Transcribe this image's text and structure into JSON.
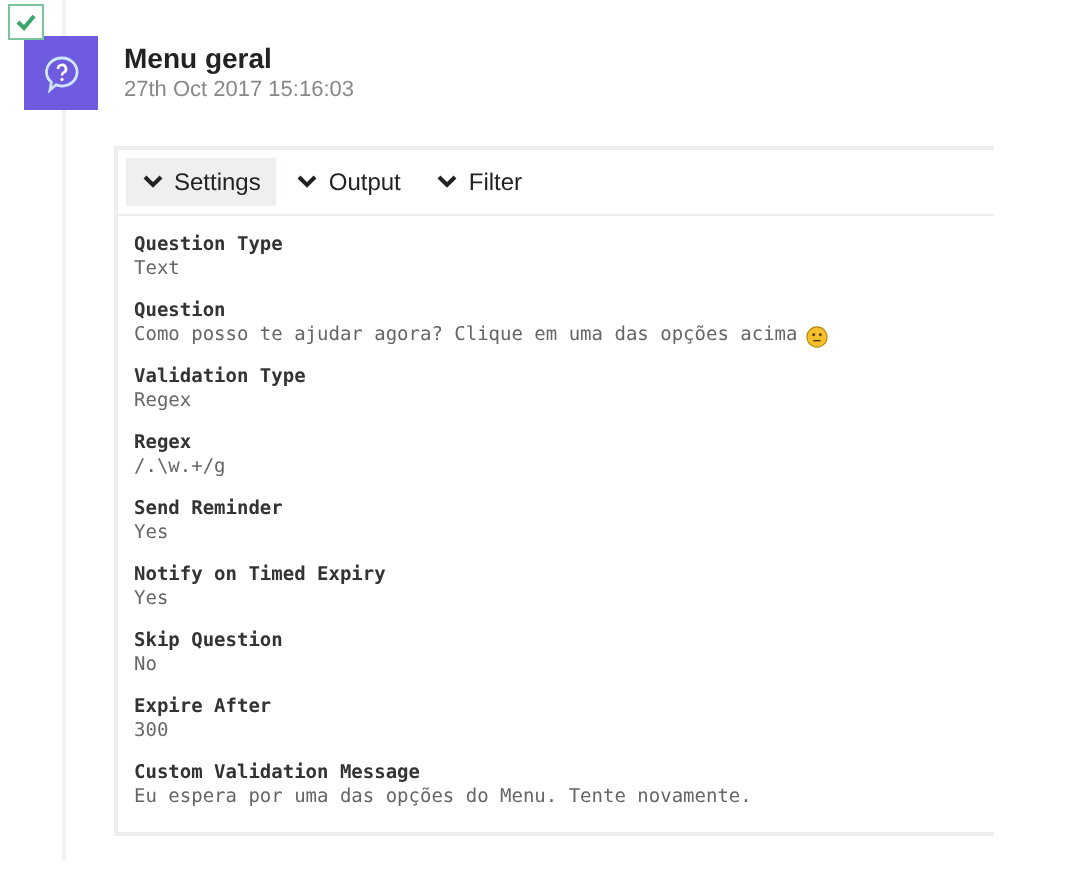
{
  "entry": {
    "checked": true,
    "title": "Menu geral",
    "timestamp": "27th Oct 2017 15:16:03"
  },
  "tabs": [
    {
      "label": "Settings",
      "selected": true
    },
    {
      "label": "Output",
      "selected": false
    },
    {
      "label": "Filter",
      "selected": false
    }
  ],
  "fields": [
    {
      "label": "Question Type",
      "value": "Text"
    },
    {
      "label": "Question",
      "value": "Como posso te ajudar agora? Clique em uma das opções acima",
      "emoji": true
    },
    {
      "label": "Validation Type",
      "value": "Regex"
    },
    {
      "label": "Regex",
      "value": "/.\\w.+/g"
    },
    {
      "label": "Send Reminder",
      "value": "Yes"
    },
    {
      "label": "Notify on Timed Expiry",
      "value": "Yes"
    },
    {
      "label": "Skip Question",
      "value": "No"
    },
    {
      "label": "Expire After",
      "value": "300"
    },
    {
      "label": "Custom Validation Message",
      "value": "Eu espera por uma das opções do Menu. Tente novamente."
    }
  ]
}
